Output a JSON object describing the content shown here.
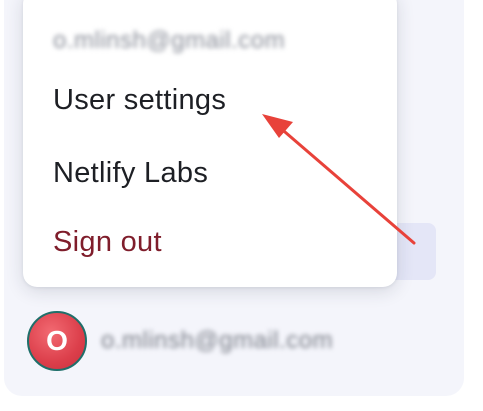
{
  "menu": {
    "email": "o.mlinsh@gmail.com",
    "items": [
      {
        "label": "User settings"
      },
      {
        "label": "Netlify Labs"
      },
      {
        "label": "Sign out"
      }
    ]
  },
  "user": {
    "avatar_letter": "O",
    "email": "o.mlinsh@gmail.com"
  },
  "colors": {
    "signout": "#7f1d2b",
    "annotation_arrow": "#e8423a",
    "avatar_bg": "#dc3f4b"
  }
}
